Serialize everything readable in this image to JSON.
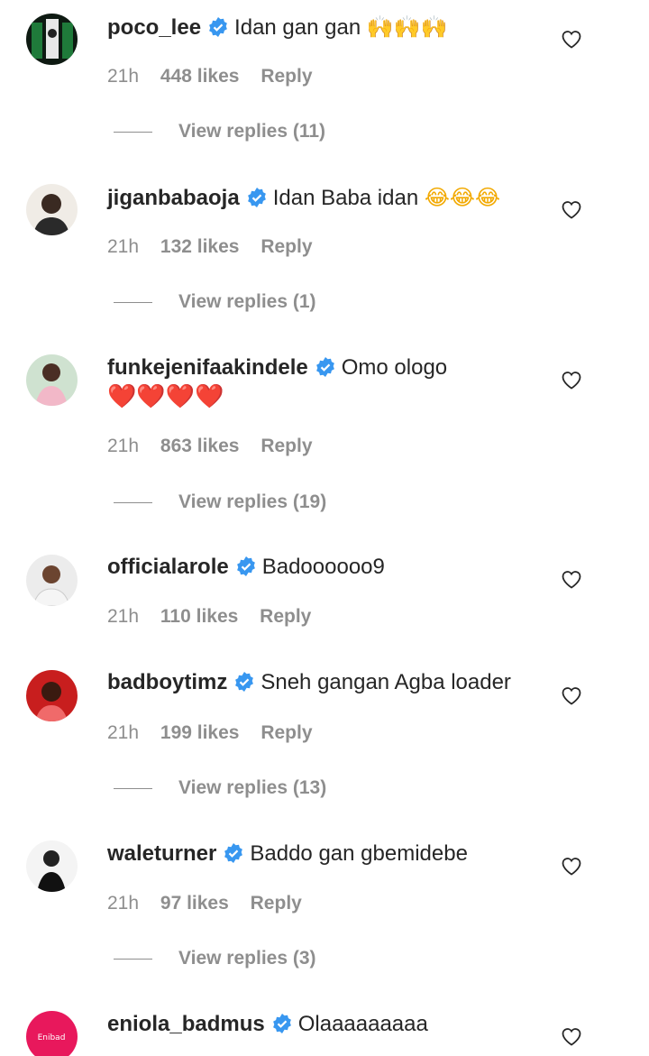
{
  "comments": [
    {
      "username": "poco_lee",
      "text": "Idan gan gan",
      "emoji": "🙌🙌🙌",
      "time": "21h",
      "likes": "448 likes",
      "reply": "Reply",
      "view_replies": "View replies (11)"
    },
    {
      "username": "jiganbabaoja",
      "text": "Idan Baba idan",
      "emoji": "😂😂😂",
      "time": "21h",
      "likes": "132 likes",
      "reply": "Reply",
      "view_replies": "View replies (1)"
    },
    {
      "username": "funkejenifaakindele",
      "text": "Omo ologo",
      "emoji": "❤️❤️❤️❤️",
      "time": "21h",
      "likes": "863 likes",
      "reply": "Reply",
      "view_replies": "View replies (19)"
    },
    {
      "username": "officialarole",
      "text": "Badoooooo9",
      "emoji": "",
      "time": "21h",
      "likes": "110 likes",
      "reply": "Reply"
    },
    {
      "username": "badboytimz",
      "text": "Sneh gangan Agba loader",
      "emoji": "",
      "time": "21h",
      "likes": "199 likes",
      "reply": "Reply",
      "view_replies": "View replies (13)"
    },
    {
      "username": "waleturner",
      "text": "Baddo gan gbemidebe",
      "emoji": "",
      "time": "21h",
      "likes": "97 likes",
      "reply": "Reply",
      "view_replies": "View replies (3)"
    },
    {
      "username": "eniola_badmus",
      "text": "Olaaaaaaaaa",
      "emoji": ""
    }
  ],
  "colors": {
    "verified": "#3897f0",
    "meta_text": "#8e8e8e",
    "primary_text": "#262626"
  }
}
